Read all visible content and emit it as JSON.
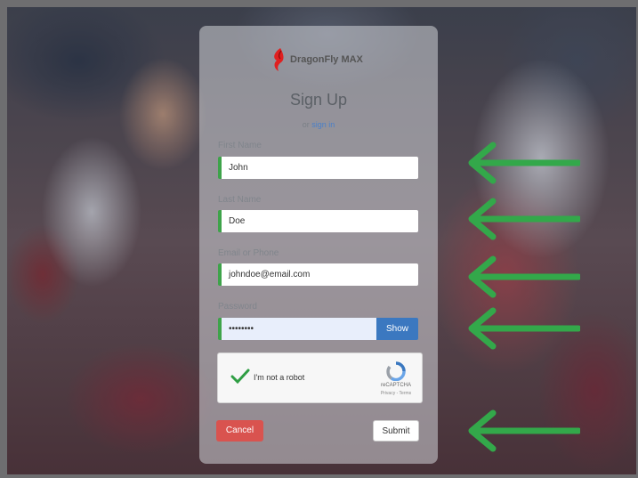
{
  "brand": {
    "name": "DragonFly MAX",
    "logo_color": "#e02020"
  },
  "form": {
    "title": "Sign Up",
    "or_text": "or",
    "sign_in_link": "sign in",
    "first_name": {
      "label": "First Name",
      "value": "John"
    },
    "last_name": {
      "label": "Last Name",
      "value": "Doe"
    },
    "email": {
      "label": "Email or Phone",
      "value": "johndoe@email.com"
    },
    "password": {
      "label": "Password",
      "value": "••••••••",
      "show_label": "Show"
    },
    "captcha": {
      "label": "I'm not a robot",
      "brand": "reCAPTCHA",
      "terms": "Privacy - Terms"
    },
    "cancel_label": "Cancel",
    "submit_label": "Submit"
  },
  "colors": {
    "accent_green": "#3ea34a",
    "arrow_green": "#33a84a",
    "cancel_red": "#d9534f",
    "show_blue": "#3b78c0"
  },
  "annotations": {
    "arrow_icon": "left-arrow-icon",
    "count": 5
  }
}
